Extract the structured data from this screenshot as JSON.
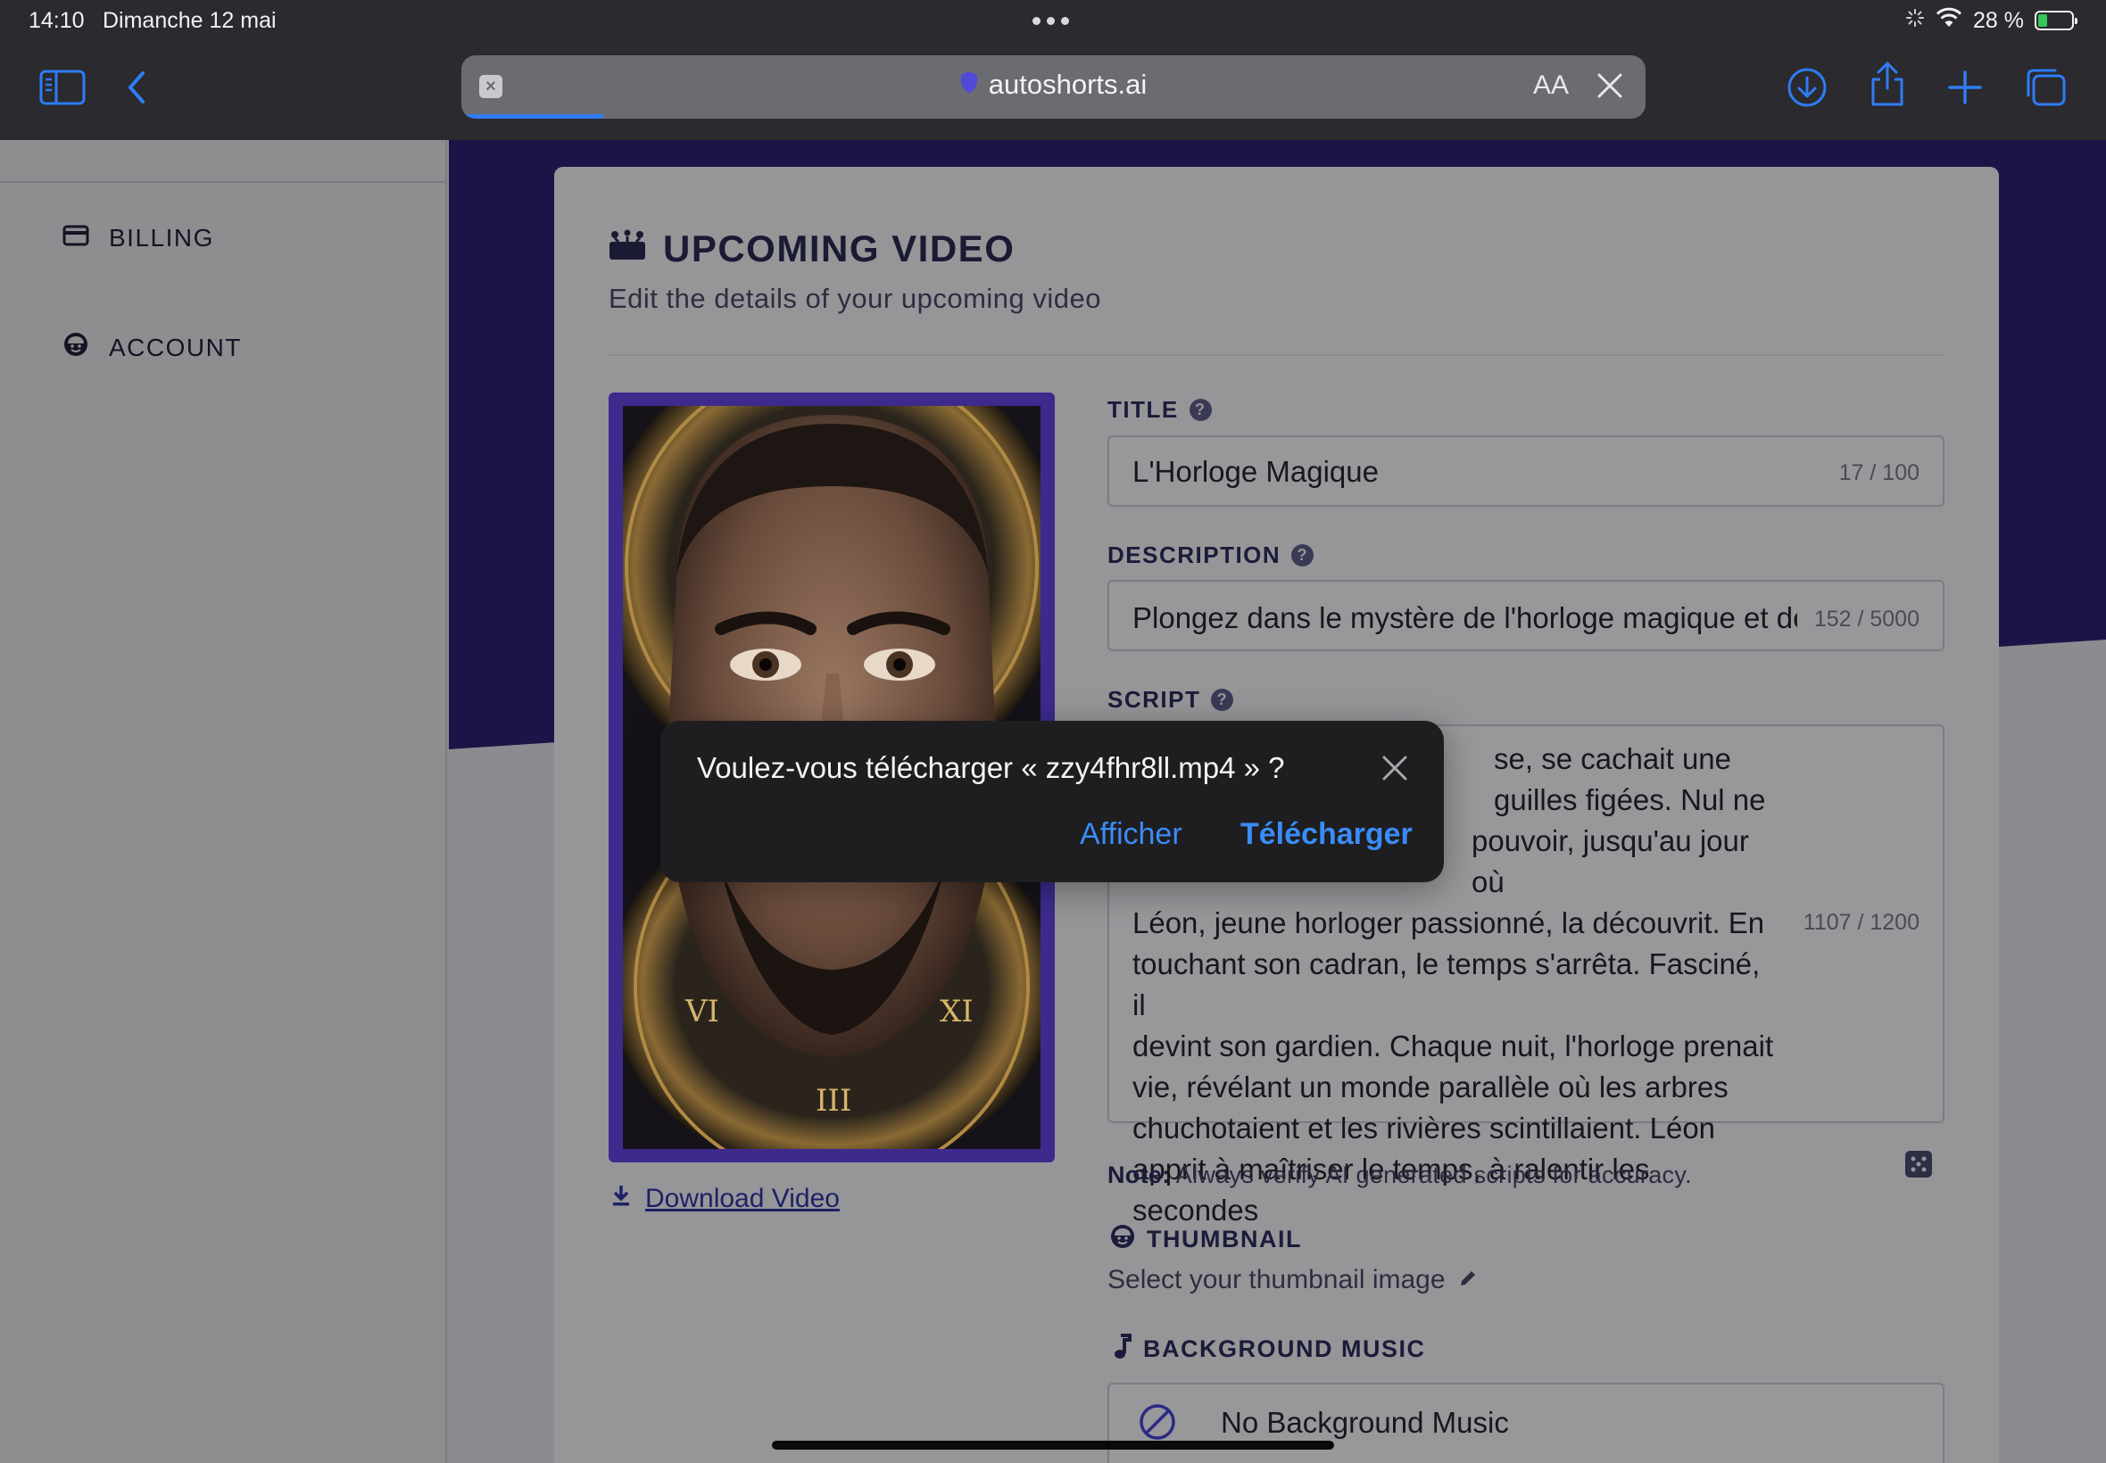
{
  "status_bar": {
    "time": "14:10",
    "date": "Dimanche 12 mai",
    "battery": "28 %",
    "battery_level": 0.28
  },
  "browser": {
    "url": "autoshorts.ai",
    "reader_label": "AA",
    "load_progress": 0.12
  },
  "sidebar": {
    "items": [
      {
        "label": "BILLING",
        "icon": "credit-card-icon"
      },
      {
        "label": "ACCOUNT",
        "icon": "smiley-face-icon"
      }
    ]
  },
  "card": {
    "title": "UPCOMING VIDEO",
    "subtitle": "Edit the details of your upcoming video",
    "download_link": "Download Video"
  },
  "form": {
    "title_label": "TITLE",
    "title_value": "L'Horloge Magique",
    "title_counter": "17 / 100",
    "description_label": "DESCRIPTION",
    "description_value": "Plongez dans le mystère de l'horloge magique et dé",
    "description_counter": "152 / 5000",
    "script_label": "SCRIPT",
    "script_lines": [
      "se, se cachait une",
      "guilles figées. Nul ne",
      "pouvoir, jusqu'au jour où",
      "Léon, jeune horloger passionné, la découvrit. En",
      "touchant son cadran, le temps s'arrêta. Fasciné, il",
      "devint son gardien. Chaque nuit, l'horloge prenait",
      "vie, révélant un monde parallèle où les arbres",
      "chuchotaient et les rivières scintillaient. Léon",
      "apprit à maîtriser le temps, à ralentir les secondes"
    ],
    "script_counter": "1107 / 1200",
    "note_label": "Note:",
    "note_text": " Always verify AI generated scripts for accuracy."
  },
  "thumbnail": {
    "label": "THUMBNAIL",
    "hint": "Select your thumbnail image"
  },
  "music": {
    "label": "BACKGROUND MUSIC",
    "option": "No Background Music"
  },
  "dialog": {
    "message": "Voulez-vous télécharger « zzy4fhr8ll.mp4 » ?",
    "show_label": "Afficher",
    "download_label": "Télécharger"
  },
  "colors": {
    "accent_blue": "#3a8cf7",
    "dark_navy": "#1b1547",
    "video_frame": "#3d2a8c"
  }
}
